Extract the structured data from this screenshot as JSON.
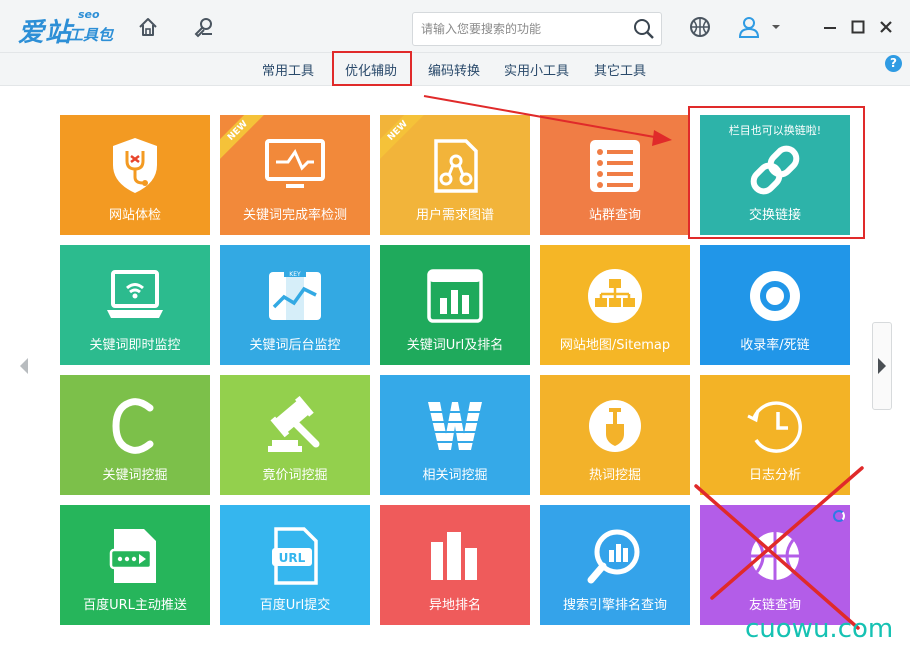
{
  "app": {
    "logo_main": "爱站",
    "logo_seo": "seo",
    "logo_sub": "工具包"
  },
  "search": {
    "placeholder": "请输入您要搜索的功能"
  },
  "tabs": [
    {
      "label": "常用工具"
    },
    {
      "label": "优化辅助"
    },
    {
      "label": "编码转换"
    },
    {
      "label": "实用小工具"
    },
    {
      "label": "其它工具"
    }
  ],
  "help_label": "?",
  "tiles": [
    {
      "label": "网站体检",
      "color": "#f39a22",
      "icon": "shield-stethoscope-icon"
    },
    {
      "label": "关键词完成率检测",
      "color": "#f2893a",
      "icon": "monitor-pulse-icon",
      "badge": "NEW"
    },
    {
      "label": "用户需求图谱",
      "color": "#f2b43a",
      "icon": "graph-nodes-icon",
      "badge": "NEW"
    },
    {
      "label": "站群查询",
      "color": "#f07d45",
      "icon": "list-document-icon"
    },
    {
      "label": "交换链接",
      "color": "#2db3a9",
      "icon": "chain-link-icon",
      "tip": "栏目也可以换链啦!"
    },
    {
      "label": "关键词即时监控",
      "color": "#2cbb8e",
      "icon": "laptop-wifi-icon"
    },
    {
      "label": "关键词后台监控",
      "color": "#33a9e3",
      "icon": "map-trend-icon"
    },
    {
      "label": "关键词Url及排名",
      "color": "#1faa5c",
      "icon": "bar-chart-window-icon"
    },
    {
      "label": "网站地图/Sitemap",
      "color": "#f5b626",
      "icon": "sitemap-icon"
    },
    {
      "label": "收录率/死链",
      "color": "#2196e8",
      "icon": "ring-icon"
    },
    {
      "label": "关键词挖掘",
      "color": "#7cc04a",
      "icon": "letter-c-icon"
    },
    {
      "label": "竟价词挖掘",
      "color": "#93d04d",
      "icon": "gavel-icon"
    },
    {
      "label": "相关词挖掘",
      "color": "#35a9e8",
      "icon": "letter-w-icon"
    },
    {
      "label": "热词挖掘",
      "color": "#f3b22a",
      "icon": "shovel-icon"
    },
    {
      "label": "日志分析",
      "color": "#f3b326",
      "icon": "clock-icon"
    },
    {
      "label": "百度URL主动推送",
      "color": "#26b55b",
      "icon": "url-push-icon"
    },
    {
      "label": "百度Url提交",
      "color": "#35b6ee",
      "icon": "url-file-icon"
    },
    {
      "label": "异地排名",
      "color": "#ef5b5b",
      "icon": "columns-icon"
    },
    {
      "label": "搜索引擎排名查询",
      "color": "#34a3ea",
      "icon": "magnifier-chart-icon"
    },
    {
      "label": "友链查询",
      "color": "#b35de8",
      "icon": "basketball-icon"
    }
  ],
  "watermark": "cuowu.com",
  "colors": {
    "annotation": "#e02a2a",
    "accent": "#2d8fd6",
    "watermark": "#16c2b3"
  }
}
